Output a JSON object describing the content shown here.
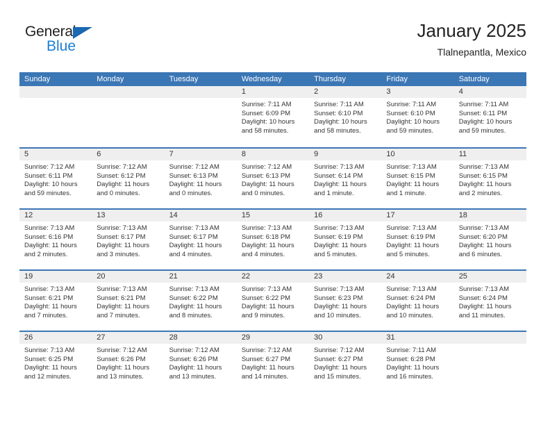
{
  "brand": {
    "name_top": "General",
    "name_bottom": "Blue",
    "color_dark": "#231f20",
    "color_blue": "#1b7fd4",
    "triangle_color": "#1b68b3"
  },
  "header": {
    "title": "January 2025",
    "subtitle": "Tlalnepantla, Mexico"
  },
  "theme": {
    "header_bar": "#3b76b5",
    "day_band": "#efefef",
    "text": "#333333"
  },
  "weekdays": [
    "Sunday",
    "Monday",
    "Tuesday",
    "Wednesday",
    "Thursday",
    "Friday",
    "Saturday"
  ],
  "weeks": [
    [
      {
        "day": "",
        "lines": []
      },
      {
        "day": "",
        "lines": []
      },
      {
        "day": "",
        "lines": []
      },
      {
        "day": "1",
        "lines": [
          "Sunrise: 7:11 AM",
          "Sunset: 6:09 PM",
          "Daylight: 10 hours",
          "and 58 minutes."
        ]
      },
      {
        "day": "2",
        "lines": [
          "Sunrise: 7:11 AM",
          "Sunset: 6:10 PM",
          "Daylight: 10 hours",
          "and 58 minutes."
        ]
      },
      {
        "day": "3",
        "lines": [
          "Sunrise: 7:11 AM",
          "Sunset: 6:10 PM",
          "Daylight: 10 hours",
          "and 59 minutes."
        ]
      },
      {
        "day": "4",
        "lines": [
          "Sunrise: 7:11 AM",
          "Sunset: 6:11 PM",
          "Daylight: 10 hours",
          "and 59 minutes."
        ]
      }
    ],
    [
      {
        "day": "5",
        "lines": [
          "Sunrise: 7:12 AM",
          "Sunset: 6:11 PM",
          "Daylight: 10 hours",
          "and 59 minutes."
        ]
      },
      {
        "day": "6",
        "lines": [
          "Sunrise: 7:12 AM",
          "Sunset: 6:12 PM",
          "Daylight: 11 hours",
          "and 0 minutes."
        ]
      },
      {
        "day": "7",
        "lines": [
          "Sunrise: 7:12 AM",
          "Sunset: 6:13 PM",
          "Daylight: 11 hours",
          "and 0 minutes."
        ]
      },
      {
        "day": "8",
        "lines": [
          "Sunrise: 7:12 AM",
          "Sunset: 6:13 PM",
          "Daylight: 11 hours",
          "and 0 minutes."
        ]
      },
      {
        "day": "9",
        "lines": [
          "Sunrise: 7:13 AM",
          "Sunset: 6:14 PM",
          "Daylight: 11 hours",
          "and 1 minute."
        ]
      },
      {
        "day": "10",
        "lines": [
          "Sunrise: 7:13 AM",
          "Sunset: 6:15 PM",
          "Daylight: 11 hours",
          "and 1 minute."
        ]
      },
      {
        "day": "11",
        "lines": [
          "Sunrise: 7:13 AM",
          "Sunset: 6:15 PM",
          "Daylight: 11 hours",
          "and 2 minutes."
        ]
      }
    ],
    [
      {
        "day": "12",
        "lines": [
          "Sunrise: 7:13 AM",
          "Sunset: 6:16 PM",
          "Daylight: 11 hours",
          "and 2 minutes."
        ]
      },
      {
        "day": "13",
        "lines": [
          "Sunrise: 7:13 AM",
          "Sunset: 6:17 PM",
          "Daylight: 11 hours",
          "and 3 minutes."
        ]
      },
      {
        "day": "14",
        "lines": [
          "Sunrise: 7:13 AM",
          "Sunset: 6:17 PM",
          "Daylight: 11 hours",
          "and 4 minutes."
        ]
      },
      {
        "day": "15",
        "lines": [
          "Sunrise: 7:13 AM",
          "Sunset: 6:18 PM",
          "Daylight: 11 hours",
          "and 4 minutes."
        ]
      },
      {
        "day": "16",
        "lines": [
          "Sunrise: 7:13 AM",
          "Sunset: 6:19 PM",
          "Daylight: 11 hours",
          "and 5 minutes."
        ]
      },
      {
        "day": "17",
        "lines": [
          "Sunrise: 7:13 AM",
          "Sunset: 6:19 PM",
          "Daylight: 11 hours",
          "and 5 minutes."
        ]
      },
      {
        "day": "18",
        "lines": [
          "Sunrise: 7:13 AM",
          "Sunset: 6:20 PM",
          "Daylight: 11 hours",
          "and 6 minutes."
        ]
      }
    ],
    [
      {
        "day": "19",
        "lines": [
          "Sunrise: 7:13 AM",
          "Sunset: 6:21 PM",
          "Daylight: 11 hours",
          "and 7 minutes."
        ]
      },
      {
        "day": "20",
        "lines": [
          "Sunrise: 7:13 AM",
          "Sunset: 6:21 PM",
          "Daylight: 11 hours",
          "and 7 minutes."
        ]
      },
      {
        "day": "21",
        "lines": [
          "Sunrise: 7:13 AM",
          "Sunset: 6:22 PM",
          "Daylight: 11 hours",
          "and 8 minutes."
        ]
      },
      {
        "day": "22",
        "lines": [
          "Sunrise: 7:13 AM",
          "Sunset: 6:22 PM",
          "Daylight: 11 hours",
          "and 9 minutes."
        ]
      },
      {
        "day": "23",
        "lines": [
          "Sunrise: 7:13 AM",
          "Sunset: 6:23 PM",
          "Daylight: 11 hours",
          "and 10 minutes."
        ]
      },
      {
        "day": "24",
        "lines": [
          "Sunrise: 7:13 AM",
          "Sunset: 6:24 PM",
          "Daylight: 11 hours",
          "and 10 minutes."
        ]
      },
      {
        "day": "25",
        "lines": [
          "Sunrise: 7:13 AM",
          "Sunset: 6:24 PM",
          "Daylight: 11 hours",
          "and 11 minutes."
        ]
      }
    ],
    [
      {
        "day": "26",
        "lines": [
          "Sunrise: 7:13 AM",
          "Sunset: 6:25 PM",
          "Daylight: 11 hours",
          "and 12 minutes."
        ]
      },
      {
        "day": "27",
        "lines": [
          "Sunrise: 7:12 AM",
          "Sunset: 6:26 PM",
          "Daylight: 11 hours",
          "and 13 minutes."
        ]
      },
      {
        "day": "28",
        "lines": [
          "Sunrise: 7:12 AM",
          "Sunset: 6:26 PM",
          "Daylight: 11 hours",
          "and 13 minutes."
        ]
      },
      {
        "day": "29",
        "lines": [
          "Sunrise: 7:12 AM",
          "Sunset: 6:27 PM",
          "Daylight: 11 hours",
          "and 14 minutes."
        ]
      },
      {
        "day": "30",
        "lines": [
          "Sunrise: 7:12 AM",
          "Sunset: 6:27 PM",
          "Daylight: 11 hours",
          "and 15 minutes."
        ]
      },
      {
        "day": "31",
        "lines": [
          "Sunrise: 7:11 AM",
          "Sunset: 6:28 PM",
          "Daylight: 11 hours",
          "and 16 minutes."
        ]
      },
      {
        "day": "",
        "lines": []
      }
    ]
  ]
}
